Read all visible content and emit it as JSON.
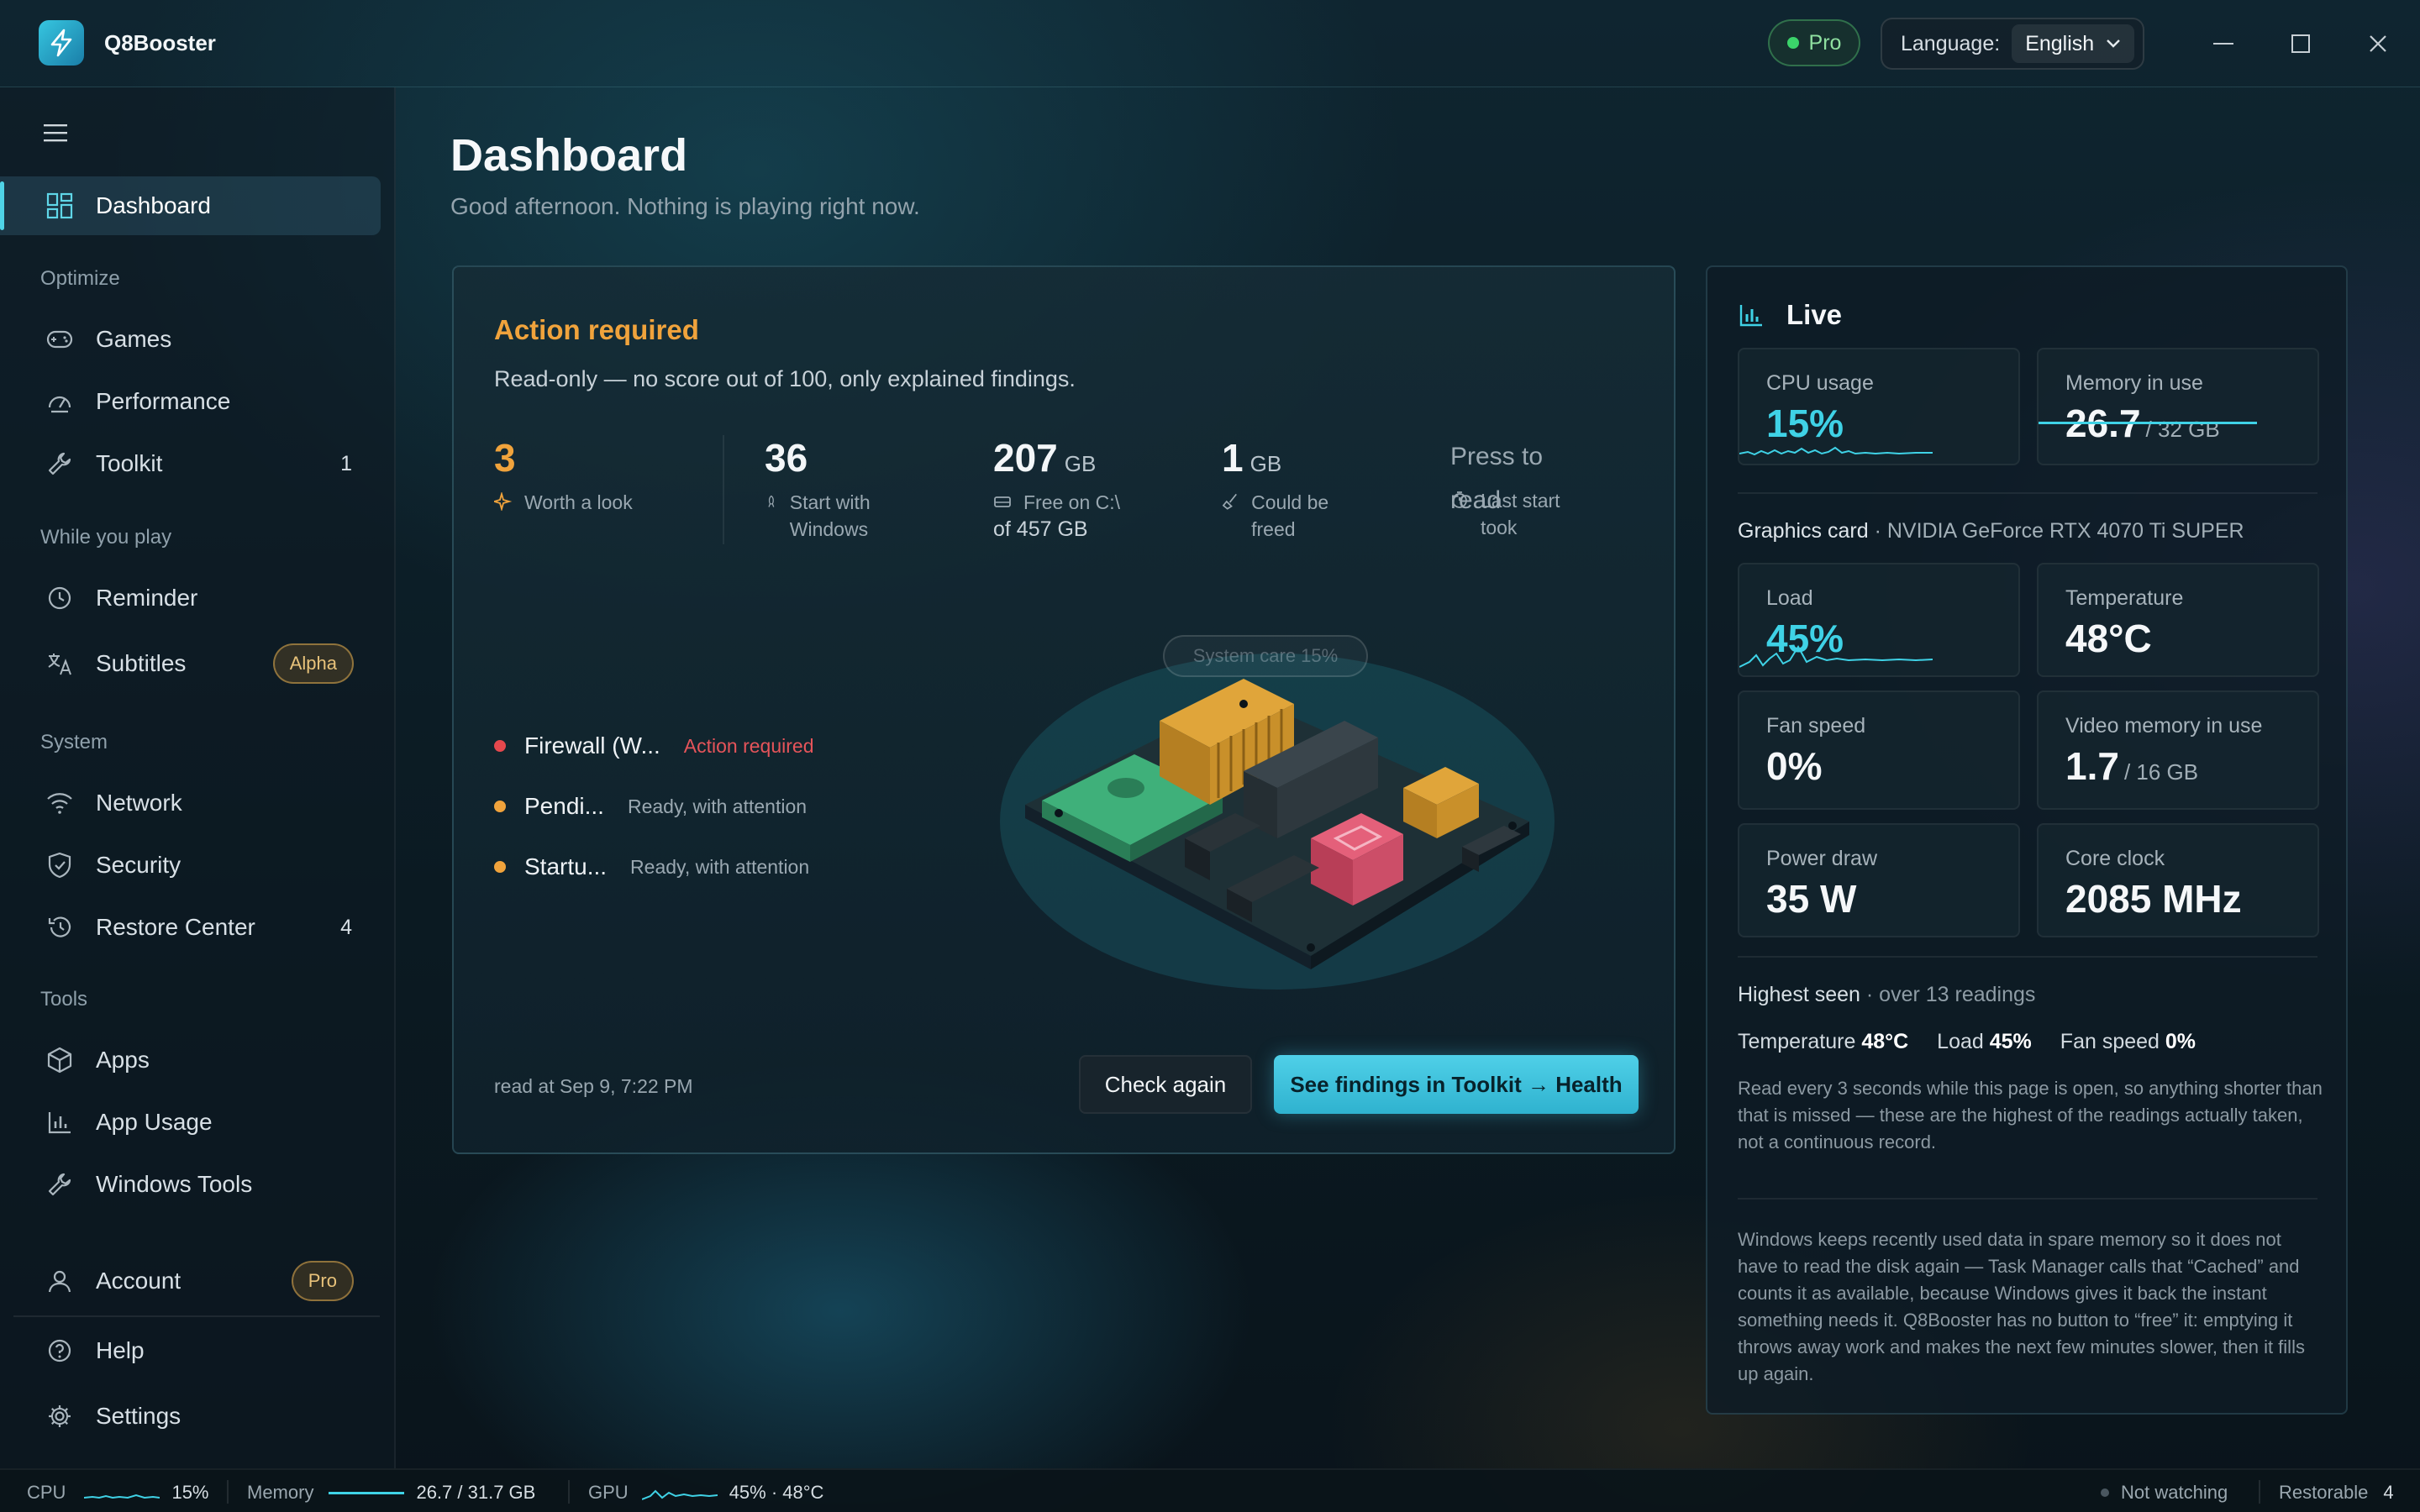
{
  "app": {
    "title": "Q8Booster",
    "pro_label": "Pro",
    "language_label": "Language:",
    "language_value": "English"
  },
  "sidebar": {
    "items": [
      {
        "label": "Dashboard"
      },
      {
        "label": "Games"
      },
      {
        "label": "Performance"
      },
      {
        "label": "Toolkit",
        "count": "1"
      },
      {
        "label": "Reminder"
      },
      {
        "label": "Subtitles",
        "badge": "Alpha"
      },
      {
        "label": "Network"
      },
      {
        "label": "Security"
      },
      {
        "label": "Restore Center",
        "count": "4"
      },
      {
        "label": "Apps"
      },
      {
        "label": "App Usage"
      },
      {
        "label": "Windows Tools"
      },
      {
        "label": "Account",
        "badge": "Pro"
      },
      {
        "label": "Help"
      },
      {
        "label": "Settings"
      }
    ],
    "sections": {
      "optimize": "Optimize",
      "while_you_play": "While you play",
      "system": "System",
      "tools": "Tools"
    }
  },
  "header": {
    "title": "Dashboard",
    "subtitle": "Good afternoon. Nothing is playing right now."
  },
  "health": {
    "title": "Action required",
    "subtitle": "Read-only — no score out of 100, only explained findings.",
    "stats": [
      {
        "value": "3",
        "unit": "",
        "label": "Worth a look"
      },
      {
        "value": "36",
        "unit": "",
        "label": "Start with Windows"
      },
      {
        "value": "207",
        "unit": "GB",
        "label": "Free on C:\\",
        "extra": "of 457 GB"
      },
      {
        "value": "1",
        "unit": "GB",
        "label": "Could be freed"
      },
      {
        "value": "Press to read",
        "label": "Last start took"
      }
    ],
    "findings": [
      {
        "name": "Firewall (W...",
        "status": "Action required"
      },
      {
        "name": "Pendi...",
        "status": "Ready, with attention"
      },
      {
        "name": "Startu...",
        "status": "Ready, with attention"
      }
    ],
    "score_chip": "System care 15%",
    "read_at": "read at Sep 9, 7:22 PM",
    "check_again": "Check again",
    "see_findings": "See findings in Toolkit → Health",
    "colors": {
      "accent": "#f0a33c",
      "danger": "#e5484d",
      "warning": "#f0a33c"
    }
  },
  "live": {
    "title": "Live",
    "cpu": {
      "label": "CPU usage",
      "value": "15%"
    },
    "memory": {
      "label": "Memory in use",
      "value": "26.7",
      "total": "/ 32 GB"
    },
    "gpu_label": "Graphics card",
    "gpu_name": "· NVIDIA GeForce RTX 4070 Ti SUPER",
    "load": {
      "label": "Load",
      "value": "45%"
    },
    "temperature": {
      "label": "Temperature",
      "value": "48°C"
    },
    "fan": {
      "label": "Fan speed",
      "value": "0%"
    },
    "vram": {
      "label": "Video memory in use",
      "value": "1.7",
      "total": "/ 16 GB"
    },
    "power": {
      "label": "Power draw",
      "value": "35 W"
    },
    "clock": {
      "label": "Core clock",
      "value": "2085 MHz"
    },
    "highest": {
      "title": "Highest seen",
      "subtitle": "· over 13 readings",
      "temp_label": "Temperature",
      "temp_value": "48°C",
      "load_label": "Load",
      "load_value": "45%",
      "fan_label": "Fan speed",
      "fan_value": "0%"
    },
    "note1": "Read every 3 seconds while this page is open, so anything shorter than that is missed — these are the highest of the readings actually taken, not a continuous record.",
    "note2": "Windows keeps recently used data in spare memory so it does not have to read the disk again — Task Manager calls that “Cached” and counts it as available, because Windows gives it back the instant something needs it. Q8Booster has no button to “free” it: emptying it throws away work and makes the next few minutes slower, then it fills up again.",
    "accent_color": "#3fd2e6"
  },
  "statusbar": {
    "cpu_label": "CPU",
    "cpu_value": "15%",
    "mem_label": "Memory",
    "mem_value": "26.7 / 31.7 GB",
    "gpu_label": "GPU",
    "gpu_value": "45% · 48°C",
    "watch": "Not watching",
    "restorable_label": "Restorable",
    "restorable_value": "4"
  }
}
